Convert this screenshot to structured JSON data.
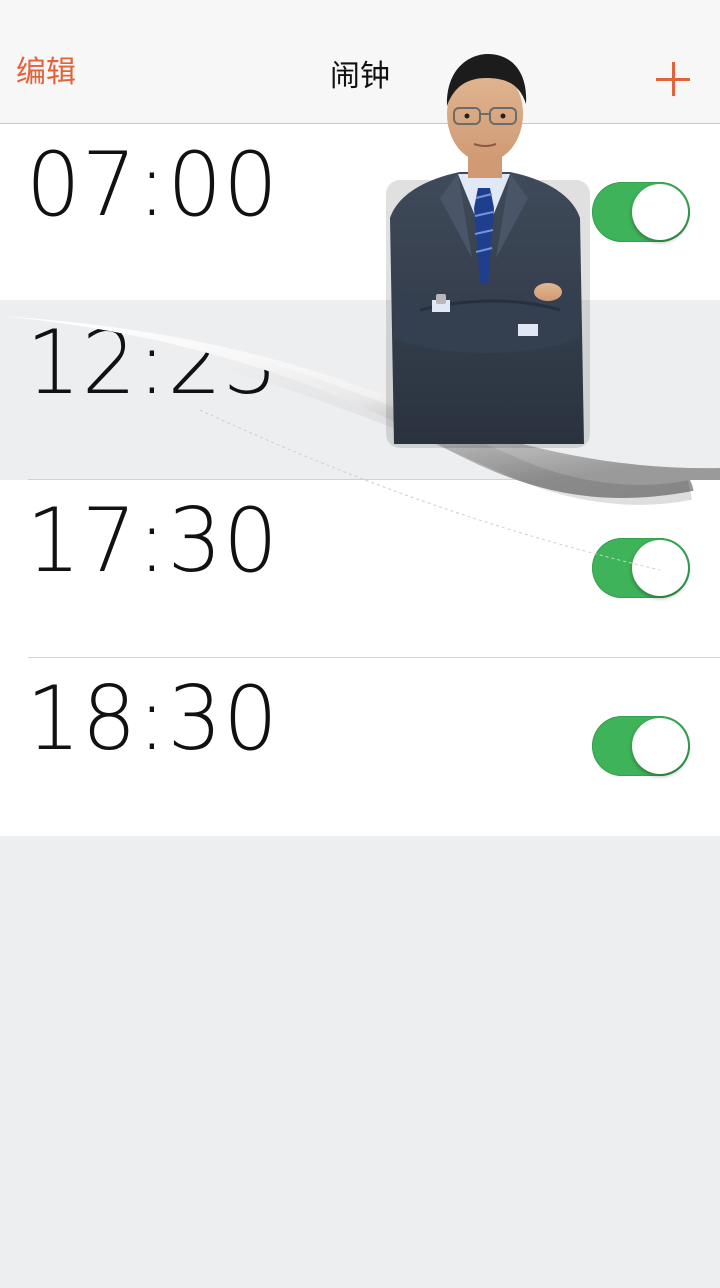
{
  "navbar": {
    "edit_label": "编辑",
    "title": "闹钟",
    "add_icon": "plus-icon"
  },
  "alarms": [
    {
      "time": "07:00",
      "enabled": true
    },
    {
      "time": "12:23",
      "enabled": true
    },
    {
      "time": "17:30",
      "enabled": true
    },
    {
      "time": "18:30",
      "enabled": true
    }
  ],
  "colors": {
    "accent": "#e2623a",
    "toggle_on": "#3fb35a",
    "background": "#edeef0"
  }
}
